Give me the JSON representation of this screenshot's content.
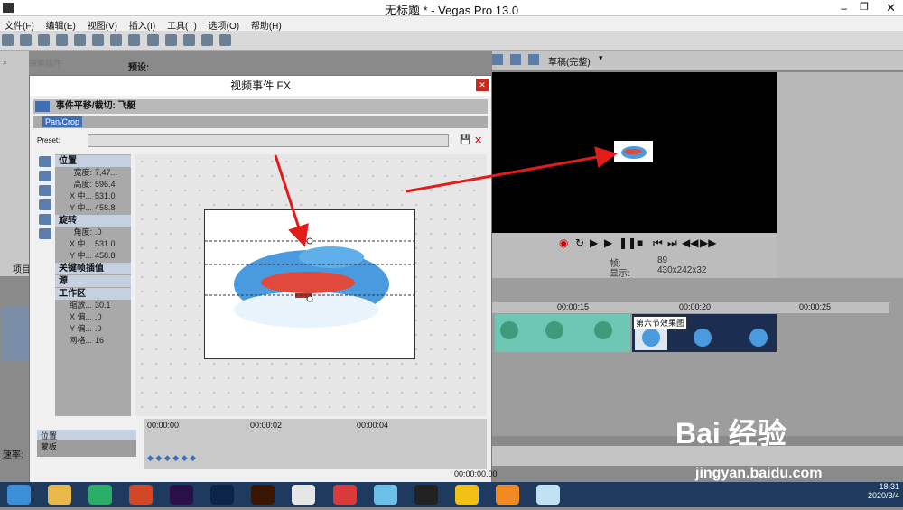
{
  "window": {
    "title": "无标题 * - Vegas Pro 13.0"
  },
  "menu": [
    "文件(F)",
    "编辑(E)",
    "视图(V)",
    "插入(I)",
    "工具(T)",
    "选项(O)",
    "帮助(H)"
  ],
  "left_panel": {
    "search_placeholder": "搜索插件",
    "preset_label": "预设:",
    "project_label": "项目"
  },
  "preview": {
    "quality": "草稿(完整)",
    "frame_label": "帧:",
    "frame_value": "89",
    "display_label": "显示:",
    "display_value": "430x242x32"
  },
  "timeline": {
    "ticks": [
      "00:00:15",
      "00:00:20",
      "00:00:25"
    ],
    "clip_label": "第六节效果图",
    "speed_label": "速率:"
  },
  "dialog": {
    "title": "视频事件 FX",
    "header": "事件平移/裁切: 飞艇",
    "plugin_name": "Pan/Crop",
    "preset_label": "Preset:",
    "sections": [
      {
        "name": "位置",
        "rows": [
          {
            "k": "宽度:",
            "v": "7,47..."
          },
          {
            "k": "高度:",
            "v": "596.4"
          },
          {
            "k": "X 中...",
            "v": "531.0"
          },
          {
            "k": "Y 中...",
            "v": "458.8"
          }
        ]
      },
      {
        "name": "旋转",
        "rows": [
          {
            "k": "角度:",
            "v": ".0"
          },
          {
            "k": "X 中...",
            "v": "531.0"
          },
          {
            "k": "Y 中...",
            "v": "458.8"
          }
        ]
      },
      {
        "name": "关键帧插值",
        "rows": []
      },
      {
        "name": "源",
        "rows": []
      },
      {
        "name": "工作区",
        "rows": [
          {
            "k": "缩放...",
            "v": "30.1"
          },
          {
            "k": "X 偏...",
            "v": ".0"
          },
          {
            "k": "Y 偏...",
            "v": ".0"
          },
          {
            "k": "网格...",
            "v": "16"
          }
        ]
      }
    ],
    "keyframe": {
      "track_position": "位置",
      "track_mask": "蒙板",
      "times": [
        "00:00:00",
        "00:00:02",
        "00:00:04"
      ],
      "current_time": "00:00:00.00"
    }
  },
  "taskbar": {
    "clock_time": "18:31",
    "clock_date": "2020/3/4"
  },
  "watermark": {
    "brand": "Bai 经验",
    "url": "jingyan.baidu.com"
  }
}
